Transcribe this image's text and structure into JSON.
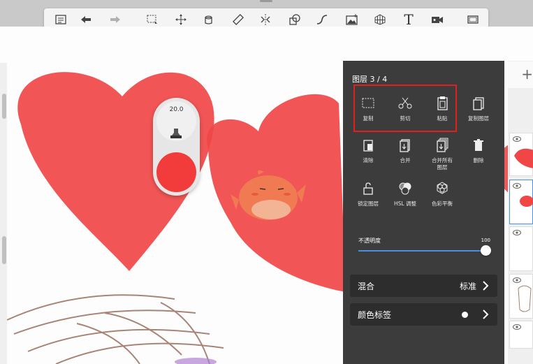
{
  "toolbar": {
    "tools": [
      {
        "name": "list-icon"
      },
      {
        "name": "undo-icon"
      },
      {
        "name": "redo-icon"
      },
      {
        "name": "select-icon"
      },
      {
        "name": "move-icon"
      },
      {
        "name": "fill-icon"
      },
      {
        "name": "ruler-icon"
      },
      {
        "name": "symmetry-icon"
      },
      {
        "name": "shape-icon"
      },
      {
        "name": "curve-icon"
      },
      {
        "name": "image-icon"
      },
      {
        "name": "perspective-icon"
      },
      {
        "name": "text-icon",
        "label": "T"
      },
      {
        "name": "video-icon"
      },
      {
        "name": "fullscreen-icon"
      }
    ]
  },
  "brush": {
    "size": "20.0",
    "color": "#f23b3b"
  },
  "layer_panel": {
    "title": "图层 3 / 4",
    "actions": [
      {
        "label": "复制"
      },
      {
        "label": "剪切"
      },
      {
        "label": "粘贴"
      },
      {
        "label": "复制图层"
      },
      {
        "label": "清除"
      },
      {
        "label": "合并"
      },
      {
        "label": "合并所有图层"
      },
      {
        "label": "删除"
      },
      {
        "label": "锁定图层"
      },
      {
        "label": "HSL 调整"
      },
      {
        "label": "色彩平衡"
      }
    ],
    "opacity_label": "不透明度",
    "opacity_value": "100",
    "opacity_fraction": 1.0,
    "blend_label": "混合",
    "blend_value": "标准",
    "color_tag_label": "颜色标签"
  },
  "layer_strip": {
    "add_label": "+"
  },
  "colors": {
    "highlight": "#e02020",
    "accent": "#4a90e2",
    "panel_bg": "#3c3c3c"
  }
}
